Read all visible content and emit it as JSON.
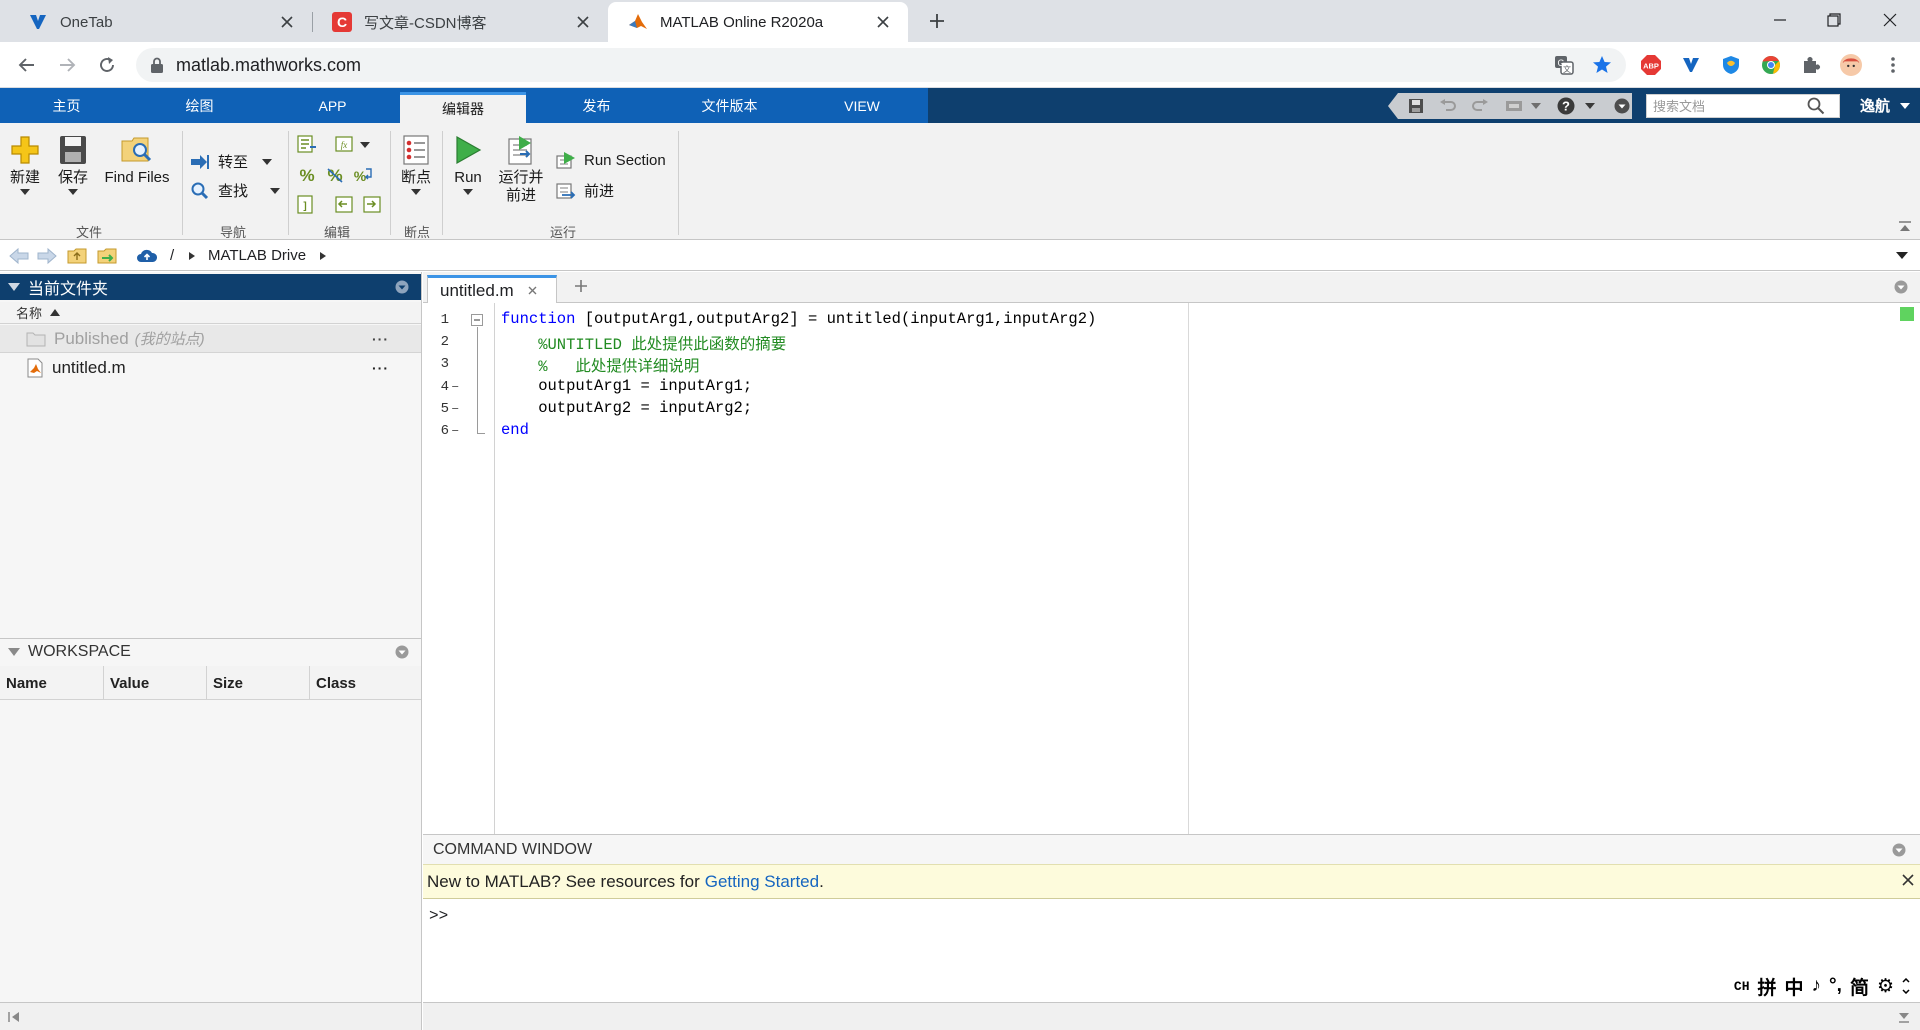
{
  "browser": {
    "tabs": [
      {
        "title": "OneTab"
      },
      {
        "title": "写文章-CSDN博客"
      },
      {
        "title": "MATLAB Online R2020a"
      }
    ],
    "url": "matlab.mathworks.com"
  },
  "ribbon": {
    "tabs": [
      "主页",
      "绘图",
      "APP",
      "编辑器",
      "发布",
      "文件版本",
      "VIEW"
    ],
    "active_tab": "编辑器",
    "search_placeholder": "搜索文档",
    "user": "逸航",
    "buttons": {
      "new": "新建",
      "save": "保存",
      "find_files": "Find Files",
      "goto": "转至",
      "find": "查找",
      "breakpoints": "断点",
      "run": "Run",
      "run_advance_1": "运行并",
      "run_advance_2": "前进",
      "run_section": "Run Section",
      "advance": "前进"
    },
    "groups": {
      "file": "文件",
      "navigate": "导航",
      "edit": "编辑",
      "breakpoints": "断点",
      "run": "运行"
    }
  },
  "pathbar": {
    "separator": "/",
    "drive": "MATLAB Drive"
  },
  "current_folder": {
    "title": "当前文件夹",
    "column_name": "名称",
    "items": [
      {
        "name": "Published",
        "note": "(我的站点)",
        "type": "folder"
      },
      {
        "name": "untitled.m",
        "type": "file"
      }
    ],
    "dots": "···"
  },
  "workspace": {
    "title": "WORKSPACE",
    "columns": [
      "Name",
      "Value",
      "Size",
      "Class"
    ]
  },
  "editor": {
    "tab": "untitled.m",
    "lines": [
      {
        "n": "1",
        "kw": "function",
        "text": " [outputArg1,outputArg2] = untitled(inputArg1,inputArg2)"
      },
      {
        "n": "2",
        "comment": "    %UNTITLED 此处提供此函数的摘要"
      },
      {
        "n": "3",
        "comment": "    %   此处提供详细说明"
      },
      {
        "n": "4",
        "dash": "–",
        "text": "    outputArg1 = inputArg1;"
      },
      {
        "n": "5",
        "dash": "–",
        "text": "    outputArg2 = inputArg2;"
      },
      {
        "n": "6",
        "dash": "–",
        "kw": "end"
      }
    ]
  },
  "command_window": {
    "title": "COMMAND WINDOW",
    "banner_text": "New to MATLAB? See resources for",
    "banner_link": "Getting Started",
    "banner_end": ".",
    "prompt": ">>"
  },
  "ime": {
    "items": [
      "CH",
      "拼",
      "中",
      "♪",
      "°,",
      "简",
      "⚙"
    ]
  }
}
